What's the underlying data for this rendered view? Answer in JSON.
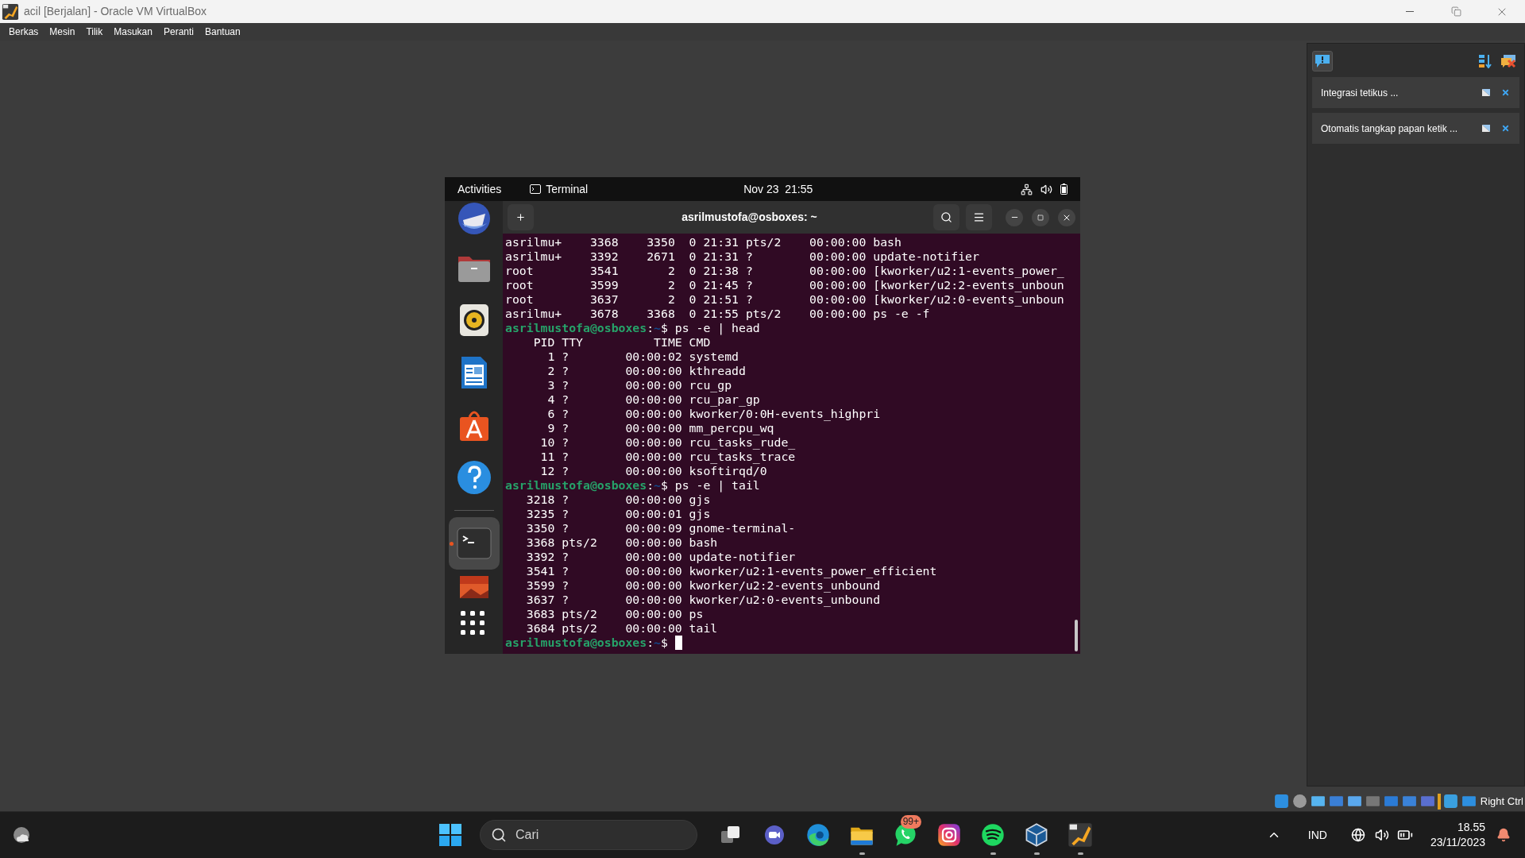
{
  "window": {
    "title": "acil [Berjalan] - Oracle VM VirtualBox"
  },
  "menu": [
    "Berkas",
    "Mesin",
    "Tilik",
    "Masukan",
    "Peranti",
    "Bantuan"
  ],
  "guest": {
    "top_bar": {
      "activities": "Activities",
      "app": "Terminal",
      "clock": "Nov 23  21:55"
    },
    "dock": [
      {
        "kind": "mail",
        "selected": false
      },
      {
        "kind": "files",
        "selected": false
      },
      {
        "kind": "music",
        "selected": false
      },
      {
        "kind": "writer",
        "selected": false
      },
      {
        "kind": "store",
        "selected": false
      },
      {
        "kind": "help",
        "selected": false
      },
      {
        "kind": "terminal",
        "selected": true
      },
      {
        "kind": "image",
        "selected": false
      },
      {
        "kind": "apps",
        "selected": false
      }
    ],
    "terminal": {
      "title": "asrilmustofa@osboxes: ~",
      "lines": [
        {
          "kind": "output",
          "text": "asrilmu+    3368    3350  0 21:31 pts/2    00:00:00 bash"
        },
        {
          "kind": "output",
          "text": "asrilmu+    3392    2671  0 21:31 ?        00:00:00 update-notifier"
        },
        {
          "kind": "output",
          "text": "root        3541       2  0 21:38 ?        00:00:00 [kworker/u2:1-events_power_"
        },
        {
          "kind": "output",
          "text": "root        3599       2  0 21:45 ?        00:00:00 [kworker/u2:2-events_unboun"
        },
        {
          "kind": "output",
          "text": "root        3637       2  0 21:51 ?        00:00:00 [kworker/u2:0-events_unboun"
        },
        {
          "kind": "output",
          "text": "asrilmu+    3678    3368  0 21:55 pts/2    00:00:00 ps -e -f"
        },
        {
          "kind": "prompt",
          "user": "asrilmustofa@osboxes",
          "sep": ":",
          "path": "~",
          "sign": "$",
          "command": "ps -e | head",
          "cursor": false
        },
        {
          "kind": "output",
          "text": "    PID TTY          TIME CMD"
        },
        {
          "kind": "output",
          "text": "      1 ?        00:00:02 systemd"
        },
        {
          "kind": "output",
          "text": "      2 ?        00:00:00 kthreadd"
        },
        {
          "kind": "output",
          "text": "      3 ?        00:00:00 rcu_gp"
        },
        {
          "kind": "output",
          "text": "      4 ?        00:00:00 rcu_par_gp"
        },
        {
          "kind": "output",
          "text": "      6 ?        00:00:00 kworker/0:0H-events_highpri"
        },
        {
          "kind": "output",
          "text": "      9 ?        00:00:00 mm_percpu_wq"
        },
        {
          "kind": "output",
          "text": "     10 ?        00:00:00 rcu_tasks_rude_"
        },
        {
          "kind": "output",
          "text": "     11 ?        00:00:00 rcu_tasks_trace"
        },
        {
          "kind": "output",
          "text": "     12 ?        00:00:00 ksoftirqd/0"
        },
        {
          "kind": "prompt",
          "user": "asrilmustofa@osboxes",
          "sep": ":",
          "path": "~",
          "sign": "$",
          "command": "ps -e | tail",
          "cursor": false
        },
        {
          "kind": "output",
          "text": "   3218 ?        00:00:00 gjs"
        },
        {
          "kind": "output",
          "text": "   3235 ?        00:00:01 gjs"
        },
        {
          "kind": "output",
          "text": "   3350 ?        00:00:09 gnome-terminal-"
        },
        {
          "kind": "output",
          "text": "   3368 pts/2    00:00:00 bash"
        },
        {
          "kind": "output",
          "text": "   3392 ?        00:00:00 update-notifier"
        },
        {
          "kind": "output",
          "text": "   3541 ?        00:00:00 kworker/u2:1-events_power_efficient"
        },
        {
          "kind": "output",
          "text": "   3599 ?        00:00:00 kworker/u2:2-events_unbound"
        },
        {
          "kind": "output",
          "text": "   3637 ?        00:00:00 kworker/u2:0-events_unbound"
        },
        {
          "kind": "output",
          "text": "   3683 pts/2    00:00:00 ps"
        },
        {
          "kind": "output",
          "text": "   3684 pts/2    00:00:00 tail"
        },
        {
          "kind": "prompt",
          "user": "asrilmustofa@osboxes",
          "sep": ":",
          "path": "~",
          "sign": "$",
          "cursor": true
        }
      ]
    }
  },
  "notifications": [
    {
      "text": "Integrasi tetikus ..."
    },
    {
      "text": "Otomatis tangkap papan ketik ..."
    }
  ],
  "status_bar": {
    "host_key": "Right Ctrl"
  },
  "taskbar": {
    "search": {
      "placeholder": "Cari"
    },
    "apps": [
      {
        "kind": "taskview",
        "running": false
      },
      {
        "kind": "meet",
        "running": false
      },
      {
        "kind": "edge",
        "running": false
      },
      {
        "kind": "explorer",
        "running": true
      },
      {
        "kind": "whatsapp",
        "running": false,
        "badge": "99+"
      },
      {
        "kind": "instagram",
        "running": false
      },
      {
        "kind": "spotify",
        "running": true
      },
      {
        "kind": "virtualbox",
        "running": true
      },
      {
        "kind": "vm",
        "running": true
      }
    ],
    "language": "IND",
    "time": "18.55",
    "date": "23/11/2023"
  }
}
